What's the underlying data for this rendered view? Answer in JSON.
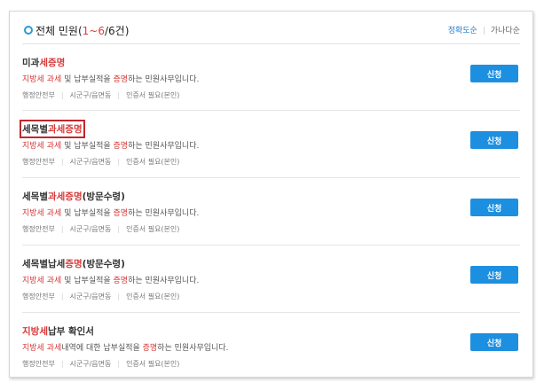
{
  "header": {
    "title_prefix": "전체 민원(",
    "title_range": "1~6",
    "title_sep": "/",
    "title_total": "6건",
    "title_suffix": ")",
    "link_accuracy": "정확도순",
    "link_alpha": "가나다순"
  },
  "items": [
    {
      "name": [
        {
          "t": "미과",
          "red": false
        },
        {
          "t": "세증명",
          "red": true
        }
      ],
      "desc": [
        {
          "t": "지방세 과세",
          "red": true
        },
        {
          "t": " 및 납부실적을 ",
          "red": false
        },
        {
          "t": "증명",
          "red": true
        },
        {
          "t": "하는 민원사무입니다.",
          "red": false
        }
      ],
      "meta": [
        "행정안전부",
        "시군구/읍면동",
        "인증서 필요(본인)"
      ],
      "button": "신청",
      "highlighted": false
    },
    {
      "name": [
        {
          "t": "세목별",
          "red": false
        },
        {
          "t": "과세증명",
          "red": true
        }
      ],
      "desc": [
        {
          "t": "지방세 과세",
          "red": true
        },
        {
          "t": " 및 납부실적을 ",
          "red": false
        },
        {
          "t": "증명",
          "red": true
        },
        {
          "t": "하는 민원사무입니다.",
          "red": false
        }
      ],
      "meta": [
        "행정안전부",
        "시군구/읍면동",
        "인증서 필요(본인)"
      ],
      "button": "신청",
      "highlighted": true
    },
    {
      "name": [
        {
          "t": "세목별",
          "red": false
        },
        {
          "t": "과세증명",
          "red": true
        },
        {
          "t": "(방문수령)",
          "red": false
        }
      ],
      "desc": [
        {
          "t": "지방세 과세",
          "red": true
        },
        {
          "t": " 및 납부실적을 ",
          "red": false
        },
        {
          "t": "증명",
          "red": true
        },
        {
          "t": "하는 민원사무입니다.",
          "red": false
        }
      ],
      "meta": [
        "행정안전부",
        "시군구/읍면동",
        "인증서 필요(본인)"
      ],
      "button": "신청",
      "highlighted": false
    },
    {
      "name": [
        {
          "t": "세목별납세",
          "red": false
        },
        {
          "t": "증명",
          "red": true
        },
        {
          "t": "(방문수령)",
          "red": false
        }
      ],
      "desc": [
        {
          "t": "지방세 과세",
          "red": true
        },
        {
          "t": " 및 납부실적을 ",
          "red": false
        },
        {
          "t": "증명",
          "red": true
        },
        {
          "t": "하는 민원사무입니다.",
          "red": false
        }
      ],
      "meta": [
        "행정안전부",
        "시군구/읍면동",
        "인증서 필요(본인)"
      ],
      "button": "신청",
      "highlighted": false
    },
    {
      "name": [
        {
          "t": "지방세",
          "red": true
        },
        {
          "t": "납부 확인서",
          "red": false
        }
      ],
      "desc": [
        {
          "t": "지방세 과세",
          "red": true
        },
        {
          "t": "내역에 대한 납부실적을 ",
          "red": false
        },
        {
          "t": "증명",
          "red": true
        },
        {
          "t": "하는 민원사무입니다.",
          "red": false
        }
      ],
      "meta": [
        "행정안전부",
        "시군구/읍면동",
        "인증서 필요(본인)"
      ],
      "button": "신청",
      "highlighted": false
    }
  ]
}
